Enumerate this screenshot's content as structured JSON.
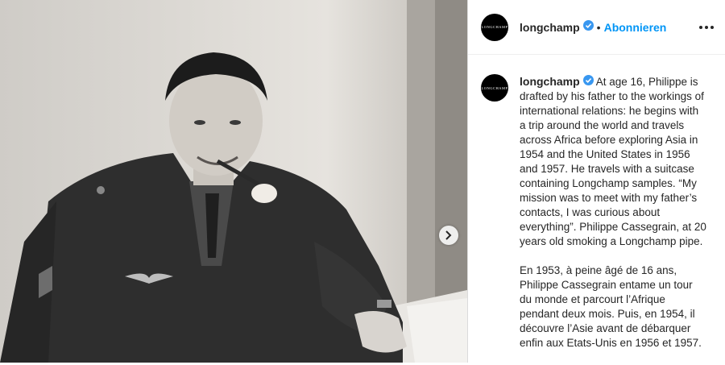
{
  "post": {
    "username": "longchamp",
    "avatar_text": "LONGCHAMP",
    "follow_label": "Abonnieren",
    "separator": "•",
    "verified_icon": "verified-badge-icon",
    "more_icon": "more-options-icon",
    "next_icon": "chevron-right-icon"
  },
  "caption": {
    "username": "longchamp",
    "en": "At age 16, Philippe is drafted by his father to the workings of international relations: he begins with a trip around the world and travels across Africa before exploring Asia in 1954 and the United States in 1956 and 1957. He travels with a suitcase containing Longchamp samples. “My mission was to meet with my father’s contacts, I was curious about everything”. Philippe Cassegrain, at 20 years old smoking a Longchamp pipe.",
    "fr": "En 1953, à peine âgé de 16 ans, Philippe Cassegrain entame un tour du monde et parcourt l’Afrique pendant deux mois. Puis, en 1954, il découvre l’Asie avant de débarquer enfin aux Etats-Unis en 1956 et 1957."
  },
  "colors": {
    "accent": "#0095f6",
    "text": "#262626"
  }
}
